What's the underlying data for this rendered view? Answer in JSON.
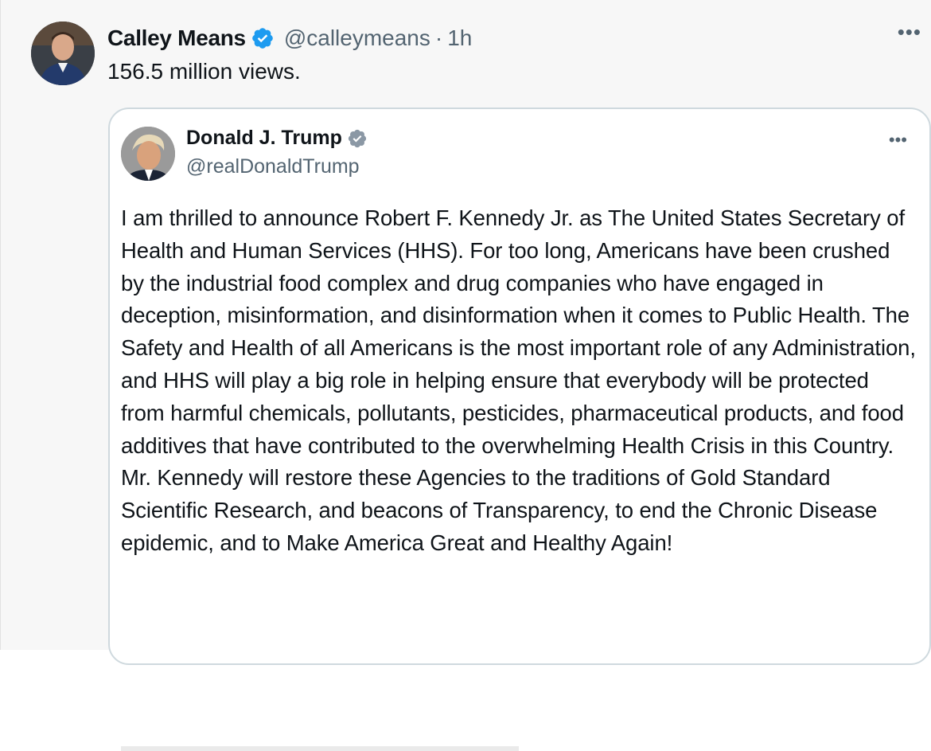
{
  "author": {
    "name": "Calley Means",
    "handle": "@calleymeans",
    "separator": "·",
    "time": "1h",
    "verified_color": "#1d9bf0"
  },
  "tweet": {
    "text": "156.5 million views."
  },
  "more_icon": "ellipsis-icon",
  "quote": {
    "author": {
      "name": "Donald J. Trump",
      "handle": "@realDonaldTrump",
      "verified_color": "#8b98a5"
    },
    "body": "I am thrilled to announce Robert F. Kennedy Jr. as The United States Secretary of Health and Human Services (HHS). For too long, Americans have been crushed by the industrial food complex and drug companies who have engaged in deception, misinformation, and disinformation when it comes to Public Health. The Safety and Health of all Americans is the most important role of any Administration, and HHS will play a big role in helping ensure that everybody will be protected from harmful chemicals, pollutants, pesticides, pharmaceutical products, and food additives that have contributed to the overwhelming Health Crisis in this Country. Mr. Kennedy will restore these Agencies to the traditions of Gold Standard Scientific Research, and beacons of Transparency, to end the Chronic Disease epidemic, and to Make America Great and Healthy Again!"
  }
}
